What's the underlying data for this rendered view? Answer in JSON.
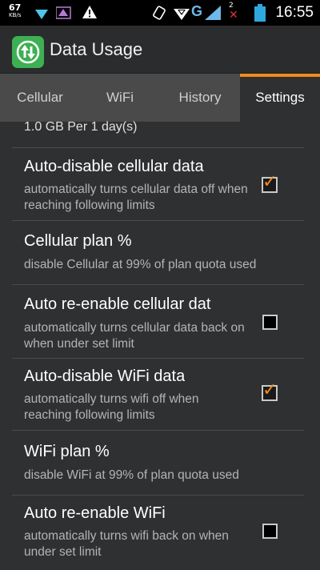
{
  "status_bar": {
    "speed_value": "67",
    "speed_unit": "KB/s",
    "signal_badge": "2",
    "time": "16:55"
  },
  "action_bar": {
    "title": "Data Usage"
  },
  "tabs": [
    {
      "label": "Cellular"
    },
    {
      "label": "WiFi"
    },
    {
      "label": "History"
    },
    {
      "label": "Settings",
      "selected": true
    }
  ],
  "settings": {
    "partial_top": "1.0 GB Per 1 day(s)",
    "items": [
      {
        "title": "Auto-disable cellular data",
        "subtitle": "automatically turns cellular data off when reaching following limits",
        "checked": true
      },
      {
        "title": "Cellular plan %",
        "subtitle": "disable Cellular at 99% of plan quota used"
      },
      {
        "title": "Auto re-enable cellular dat",
        "subtitle": "automatically turns cellular data back on when under set limit",
        "checked": false
      },
      {
        "title": "Auto-disable WiFi data",
        "subtitle": "automatically turns wifi off when reaching following limits",
        "checked": true
      },
      {
        "title": "WiFi plan %",
        "subtitle": "disable WiFi at 99% of plan quota used"
      },
      {
        "title": "Auto re-enable WiFi",
        "subtitle": "automatically turns wifi back on when under set limit",
        "checked": false
      }
    ]
  },
  "colors": {
    "accent": "#f08a1c",
    "background": "#2f3032",
    "app_icon": "#3cb052"
  }
}
